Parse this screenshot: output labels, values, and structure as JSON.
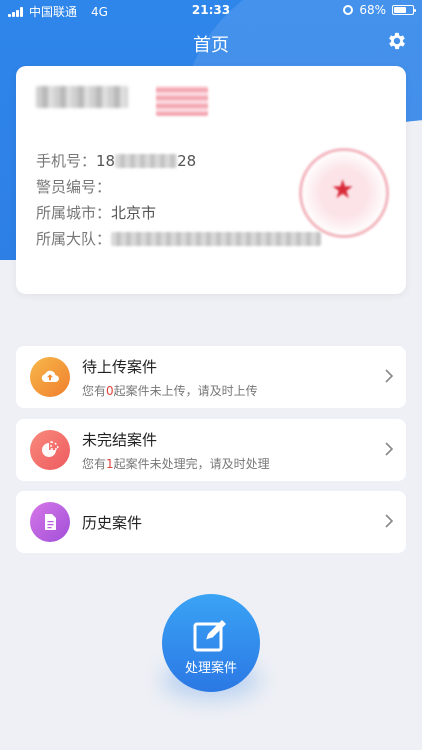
{
  "status_bar": {
    "carrier": "中国联通",
    "network": "4G",
    "time": "21:33",
    "battery": "68%",
    "battery_level": 0.68
  },
  "navbar": {
    "title": "首页",
    "settings_icon": "gear-icon"
  },
  "profile": {
    "phone_label": "手机号：",
    "phone_prefix": "18",
    "phone_suffix": "28",
    "police_id_label": "警员编号：",
    "city_label": "所属城市：",
    "city_value": "北京市",
    "team_label": "所属大队："
  },
  "cases": [
    {
      "title": "待上传案件",
      "sub_before": "您有",
      "count": "0",
      "sub_after": "起案件未上传，请及时上传",
      "icon": "cloud-upload-icon",
      "color_start": "#f7b84a",
      "color_end": "#f07f2e"
    },
    {
      "title": "未完结案件",
      "sub_before": "您有",
      "count": "1",
      "sub_after": "起案件未处理完，请及时处理",
      "icon": "pie-chart-icon",
      "color_start": "#f98a7c",
      "color_end": "#ee5a5f"
    },
    {
      "title": "历史案件",
      "icon": "document-icon",
      "color_start": "#d677e8",
      "color_end": "#a14fd8"
    }
  ],
  "fab": {
    "label": "处理案件",
    "icon": "edit-icon"
  },
  "colors": {
    "primary": "#2d7fe6",
    "background": "#eef0f5",
    "count_red": "#e0443b"
  }
}
